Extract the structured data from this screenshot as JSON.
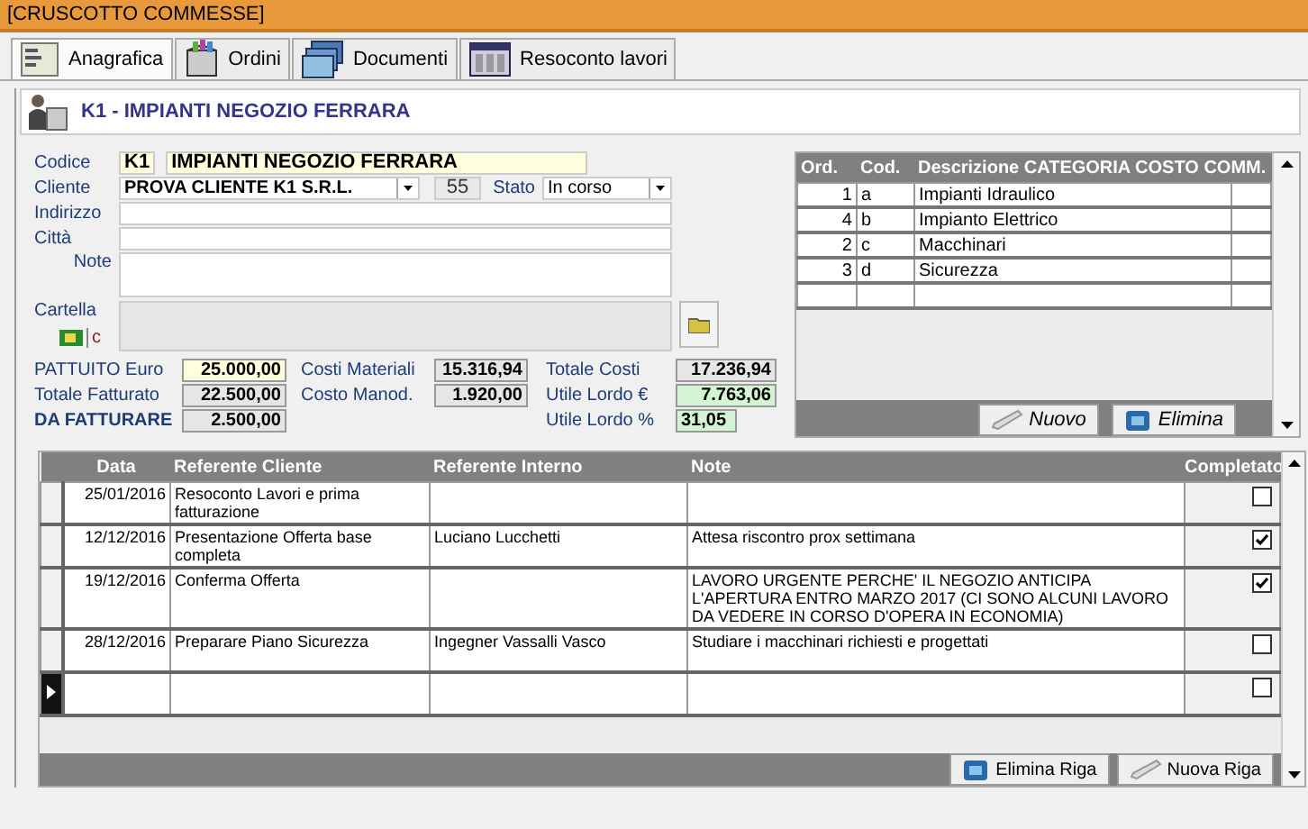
{
  "window": {
    "title": "[CRUSCOTTO COMMESSE]"
  },
  "tabs": [
    {
      "label": "Anagrafica",
      "selected": true,
      "kind": "form"
    },
    {
      "label": "Ordini",
      "selected": false,
      "kind": "box"
    },
    {
      "label": "Documenti",
      "selected": false,
      "kind": "docs"
    },
    {
      "label": "Resoconto lavori",
      "selected": false,
      "kind": "report"
    }
  ],
  "header": {
    "title": "K1 - IMPIANTI NEGOZIO FERRARA"
  },
  "form": {
    "codice": {
      "label": "Codice",
      "value": "K1",
      "description": "IMPIANTI NEGOZIO FERRARA"
    },
    "cliente": {
      "label": "Cliente",
      "value": "PROVA CLIENTE K1 S.R.L.",
      "number": "55"
    },
    "stato": {
      "label": "Stato",
      "value": "In corso"
    },
    "indirizzo": {
      "label": "Indirizzo"
    },
    "citta": {
      "label": "Città"
    },
    "note": {
      "label": "Note"
    },
    "cartella": {
      "label": "Cartella",
      "letter": "c"
    }
  },
  "totals": [
    {
      "items": [
        {
          "label": "PATTUITO Euro",
          "value": "25.000,00",
          "kind": "input"
        },
        {
          "label": "Totale Fatturato",
          "value": "22.500,00",
          "kind": "computed"
        },
        {
          "label": "DA FATTURARE",
          "value": "2.500,00",
          "kind": "due"
        }
      ]
    },
    {
      "items": [
        {
          "label": "Costi Materiali",
          "value": "15.316,94",
          "kind": "computed"
        },
        {
          "label": "Costo Manod.",
          "value": "1.920,00",
          "kind": "computed"
        }
      ]
    },
    {
      "items": [
        {
          "label": "Totale Costi",
          "value": "17.236,94",
          "kind": "computed"
        },
        {
          "label": "Utile Lordo €",
          "value": "7.763,06",
          "kind": "profit"
        },
        {
          "label": "Utile Lordo %",
          "value": "31,05",
          "kind": "profit"
        }
      ]
    }
  ],
  "categories": {
    "columns": [
      "Ord.",
      "Cod.",
      "Descrizione CATEGORIA COSTO COMM."
    ],
    "rows": [
      {
        "ord": "1",
        "cod": "a",
        "descrizione": "Impianti Idraulico"
      },
      {
        "ord": "4",
        "cod": "b",
        "descrizione": "Impianto Elettrico"
      },
      {
        "ord": "2",
        "cod": "c",
        "descrizione": "Macchinari"
      },
      {
        "ord": "3",
        "cod": "d",
        "descrizione": "Sicurezza"
      }
    ],
    "buttons": [
      {
        "label": "Nuovo",
        "kind": "new"
      },
      {
        "label": "Elimina",
        "kind": "delete"
      }
    ]
  },
  "activities": {
    "columns": [
      "Data",
      "Referente Cliente",
      "Referente Interno",
      "Note",
      "Completato"
    ],
    "rows": [
      {
        "data": "25/01/2016",
        "referente_cliente": "Resoconto Lavori e prima fatturazione",
        "completato": false,
        "selected": false
      },
      {
        "data": "12/12/2016",
        "referente_cliente": "Presentazione Offerta base completa",
        "referente_interno": "Luciano Lucchetti",
        "note": "Attesa riscontro prox settimana",
        "completato": true,
        "selected": false
      },
      {
        "data": "19/12/2016",
        "referente_cliente": "Conferma Offerta",
        "note": "LAVORO URGENTE PERCHE' IL NEGOZIO ANTICIPA L'APERTURA ENTRO MARZO 2017 (CI SONO ALCUNI LAVORO DA VEDERE IN CORSO D'OPERA IN ECONOMIA)",
        "completato": true,
        "selected": false
      },
      {
        "data": "28/12/2016",
        "referente_cliente": "Preparare Piano Sicurezza",
        "referente_interno": "Ingegner Vassalli Vasco",
        "note": "Studiare i macchinari richiesti e progettati",
        "completato": false,
        "selected": false
      },
      {
        "completato": false,
        "selected": true
      }
    ],
    "buttons": [
      {
        "label": "Elimina Riga",
        "kind": "delete"
      },
      {
        "label": "Nuova Riga",
        "kind": "new"
      }
    ]
  }
}
